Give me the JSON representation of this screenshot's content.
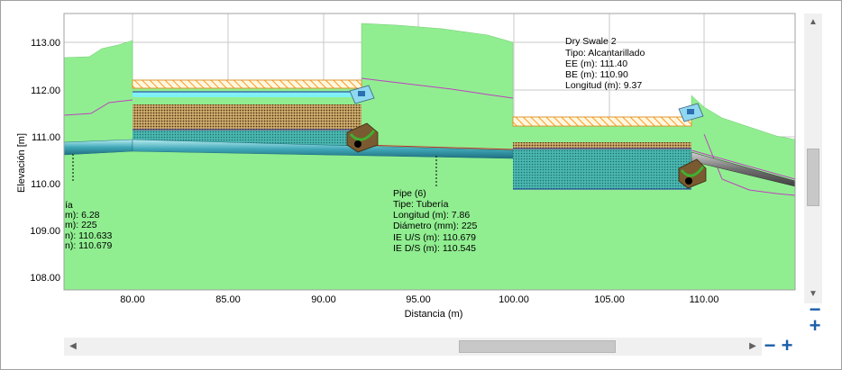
{
  "axis": {
    "ylabel": "Elevación [m]",
    "xlabel": "Distancia (m)",
    "yticks": [
      "113.00",
      "112.00",
      "111.00",
      "110.00",
      "109.00",
      "108.00"
    ],
    "xticks": [
      "80.00",
      "85.00",
      "90.00",
      "95.00",
      "100.00",
      "105.00",
      "110.00"
    ]
  },
  "tooltips": {
    "left_partial": [
      "ía",
      "m): 6.28",
      "m): 225",
      "n): 110.633",
      "n): 110.679"
    ],
    "pipe": [
      "Pipe (6)",
      "Tipe: Tubería",
      "Longitud (m): 7.86",
      "Diámetro (mm): 225",
      "IE U/S (m): 110.679",
      "IE D/S (m): 110.545"
    ],
    "swale": [
      "Dry Swale 2",
      "Tipo: Alcantarillado",
      "EE (m): 111.40",
      "BE (m): 110.90",
      "Longitud (m): 9.37"
    ]
  },
  "scroll_arrows": {
    "up": "▲",
    "down": "▼",
    "left": "◀",
    "right": "▶"
  },
  "zoom": {
    "zoom_out": "−",
    "zoom_in": "+"
  },
  "colors": {
    "ground": "#90ee90",
    "pipe": "#40a8b8",
    "hatch": "#ffa020",
    "water": "#7ff0f5",
    "link": "#c040c0"
  }
}
